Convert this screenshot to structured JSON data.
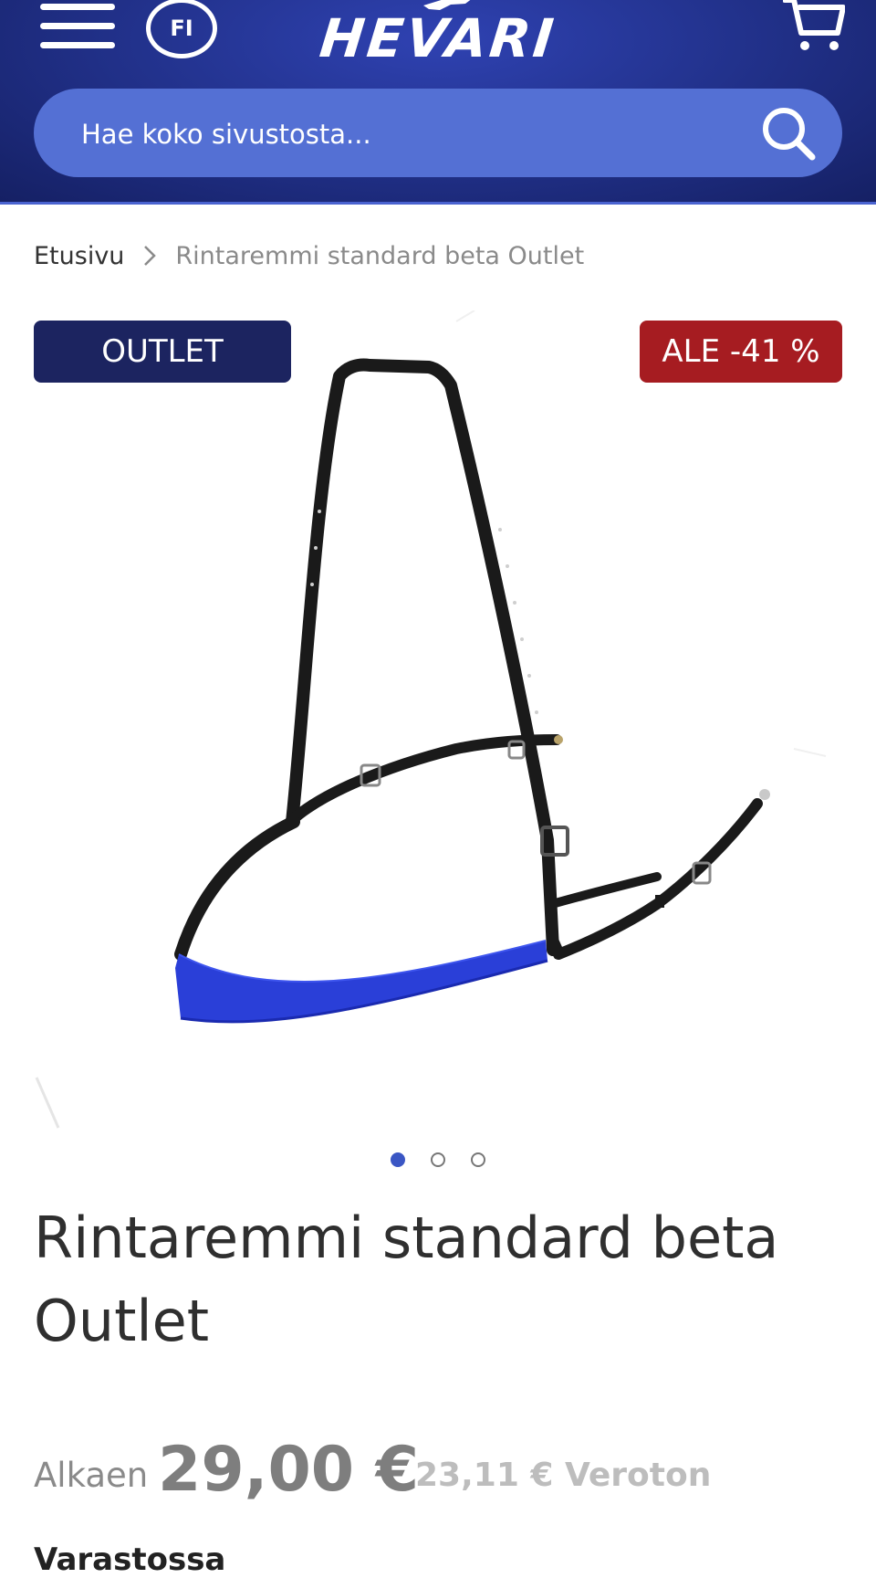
{
  "header": {
    "logo_text": "HEVARI",
    "language": "FI",
    "search_placeholder": "Hae koko sivustosta..."
  },
  "breadcrumb": {
    "home": "Etusivu",
    "current": "Rintaremmi standard beta Outlet"
  },
  "gallery": {
    "badge_outlet": "OUTLET",
    "badge_sale": "ALE -41 %",
    "image_description_icon": "breastplate-strap-image",
    "dots_total": 3,
    "active_dot": 1
  },
  "product": {
    "title_line1": "Rintaremmi standard beta",
    "title_line2": "Outlet",
    "price_prefix": "Alkaen",
    "price": "29,00 €",
    "price_net": "23,11 € Veroton",
    "stock": "Varastossa"
  },
  "colors": {
    "header_bg": "#23338f",
    "search_bg": "#5470d4",
    "outlet_badge": "#1c2460",
    "sale_badge": "#a61c21",
    "active_dot": "#3a56c4"
  }
}
